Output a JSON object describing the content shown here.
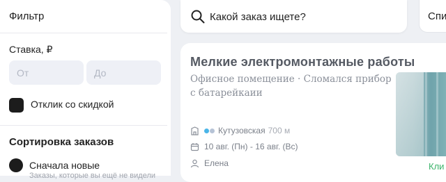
{
  "filter": {
    "title": "Фильтр",
    "rate_label": "Ставка, ₽",
    "rate_from_placeholder": "От",
    "rate_to_placeholder": "До",
    "discount_label": "Отклик со скидкой",
    "sort_title": "Сортировка заказов",
    "sort_option_label": "Сначала новые",
    "sort_option_hint": "Заказы, которые вы ещё не видели"
  },
  "search": {
    "placeholder": "Какой заказ ищете?"
  },
  "list_button": {
    "label": "Спи"
  },
  "order": {
    "title": "Мелкие электромонтажные работы",
    "description": "Офисное помещение · Сломался прибор с батарейкаии",
    "metro_station": "Кутузовская",
    "metro_distance": "700 м",
    "dates": "10 авг. (Пн) - 16 авг. (Вс)",
    "author": "Елена",
    "respond_label": "Кли",
    "metro_colors": [
      "#4ab5e8",
      "#b6c3d6"
    ]
  },
  "colors": {
    "accent_green": "#3bb36a",
    "background": "#eef0f4"
  }
}
